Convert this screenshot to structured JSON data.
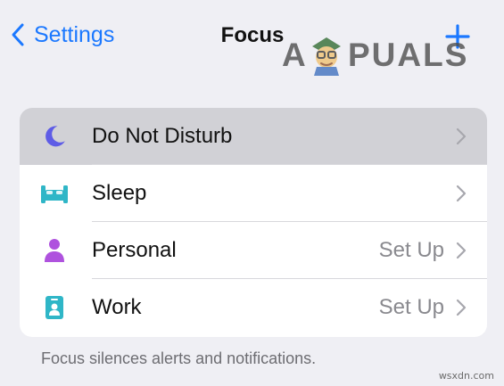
{
  "nav": {
    "back_label": "Settings",
    "back_icon": "chevron-left-icon",
    "title": "Focus",
    "add_icon": "plus-icon"
  },
  "watermark": {
    "brand_left": "A",
    "brand_right": "PUALS",
    "site": "wsxdn.com"
  },
  "focus_modes": {
    "items": [
      {
        "label": "Do Not Disturb",
        "detail": "",
        "icon": "moon-icon",
        "selected": true
      },
      {
        "label": "Sleep",
        "detail": "",
        "icon": "bed-icon",
        "selected": false
      },
      {
        "label": "Personal",
        "detail": "Set Up",
        "icon": "person-icon",
        "selected": false
      },
      {
        "label": "Work",
        "detail": "Set Up",
        "icon": "id-badge-icon",
        "selected": false
      }
    ]
  },
  "footer": {
    "text": "Focus silences alerts and notifications."
  },
  "colors": {
    "accent": "#1b78ff",
    "moon": "#5e5ce6",
    "sleep": "#2fb6c7",
    "personal": "#af52de",
    "work": "#2fb6c7",
    "selected_row": "#d1d1d6",
    "background": "#efeff4"
  }
}
